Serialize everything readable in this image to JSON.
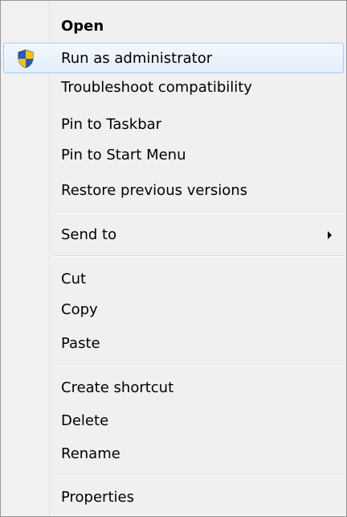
{
  "menu": {
    "items": {
      "open": "Open",
      "run_as_admin": "Run as administrator",
      "troubleshoot": "Troubleshoot compatibility",
      "pin_taskbar": "Pin to Taskbar",
      "pin_start": "Pin to Start Menu",
      "restore": "Restore previous versions",
      "send_to": "Send to",
      "cut": "Cut",
      "copy": "Copy",
      "paste": "Paste",
      "create_shortcut": "Create shortcut",
      "delete": "Delete",
      "rename": "Rename",
      "properties": "Properties"
    },
    "highlighted_item": "run_as_admin",
    "icons": {
      "run_as_admin": "uac-shield-icon",
      "send_to": "submenu-arrow-icon"
    }
  },
  "colors": {
    "menu_background": "#f0f0f0",
    "border": "#979797",
    "highlight_border": "#a8c9ee",
    "highlight_fill": "#e3eefb",
    "shield_blue": "#2a5bb8",
    "shield_yellow": "#f5c400"
  }
}
